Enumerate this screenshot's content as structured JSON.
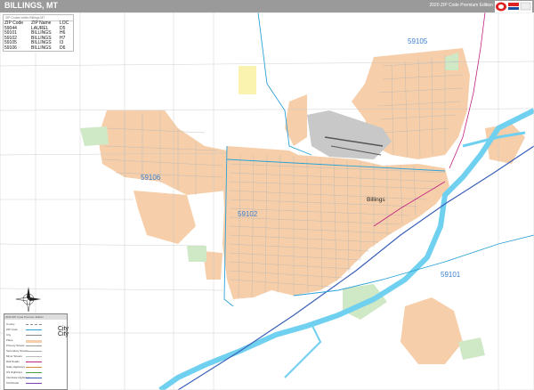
{
  "header": {
    "title": "BILLINGS, MT",
    "edition": "2020 ZIP Code Premium Edition"
  },
  "logo": {
    "brand": "Market Maps",
    "icon": "map-logo-icon"
  },
  "zip_table": {
    "caption": "ZIP Codes within Billings MT",
    "columns": [
      "ZIP Code",
      "ZIP Name",
      "LOC"
    ],
    "rows": [
      [
        "59044",
        "LAUREL",
        "D5"
      ],
      [
        "59101",
        "BILLINGS",
        "H6"
      ],
      [
        "59102",
        "BILLINGS",
        "H7"
      ],
      [
        "59105",
        "BILLINGS",
        "I3"
      ],
      [
        "59106",
        "BILLINGS",
        "D6"
      ]
    ]
  },
  "map": {
    "zip_labels": [
      "59105",
      "59106",
      "59102",
      "59101"
    ],
    "city_label": "Billings",
    "colors": {
      "zip_area": "#f6cfaa",
      "water": "#6fd0f0",
      "park": "#cfe8c6",
      "airport": "#c8c8c8",
      "zip_boundary": "#2aa1d8",
      "road": "#a8a8a8",
      "highway": "#3b5fb8",
      "railroad": "#c02080"
    }
  },
  "compass": {
    "icon": "compass-rose-icon",
    "letters": [
      "N",
      "S",
      "W",
      "E"
    ]
  },
  "legend": {
    "title": "2020 ZIP Code Premium Edition",
    "items": [
      {
        "label": "County",
        "sample": ""
      },
      {
        "label": "ZIP Code",
        "sample": "City"
      },
      {
        "label": "City",
        "sample": "City"
      },
      {
        "label": "Place",
        "sample": ""
      },
      {
        "label": "Primary Streets",
        "sample": ""
      },
      {
        "label": "Secondary Streets",
        "sample": ""
      },
      {
        "label": "Minor Streets",
        "sample": ""
      },
      {
        "label": "Rail Roads",
        "sample": ""
      },
      {
        "label": "State Highways",
        "sample": ""
      },
      {
        "label": "US Highways",
        "sample": ""
      },
      {
        "label": "Interstate Highways",
        "sample": ""
      },
      {
        "label": "Toll Roads",
        "sample": ""
      }
    ]
  }
}
